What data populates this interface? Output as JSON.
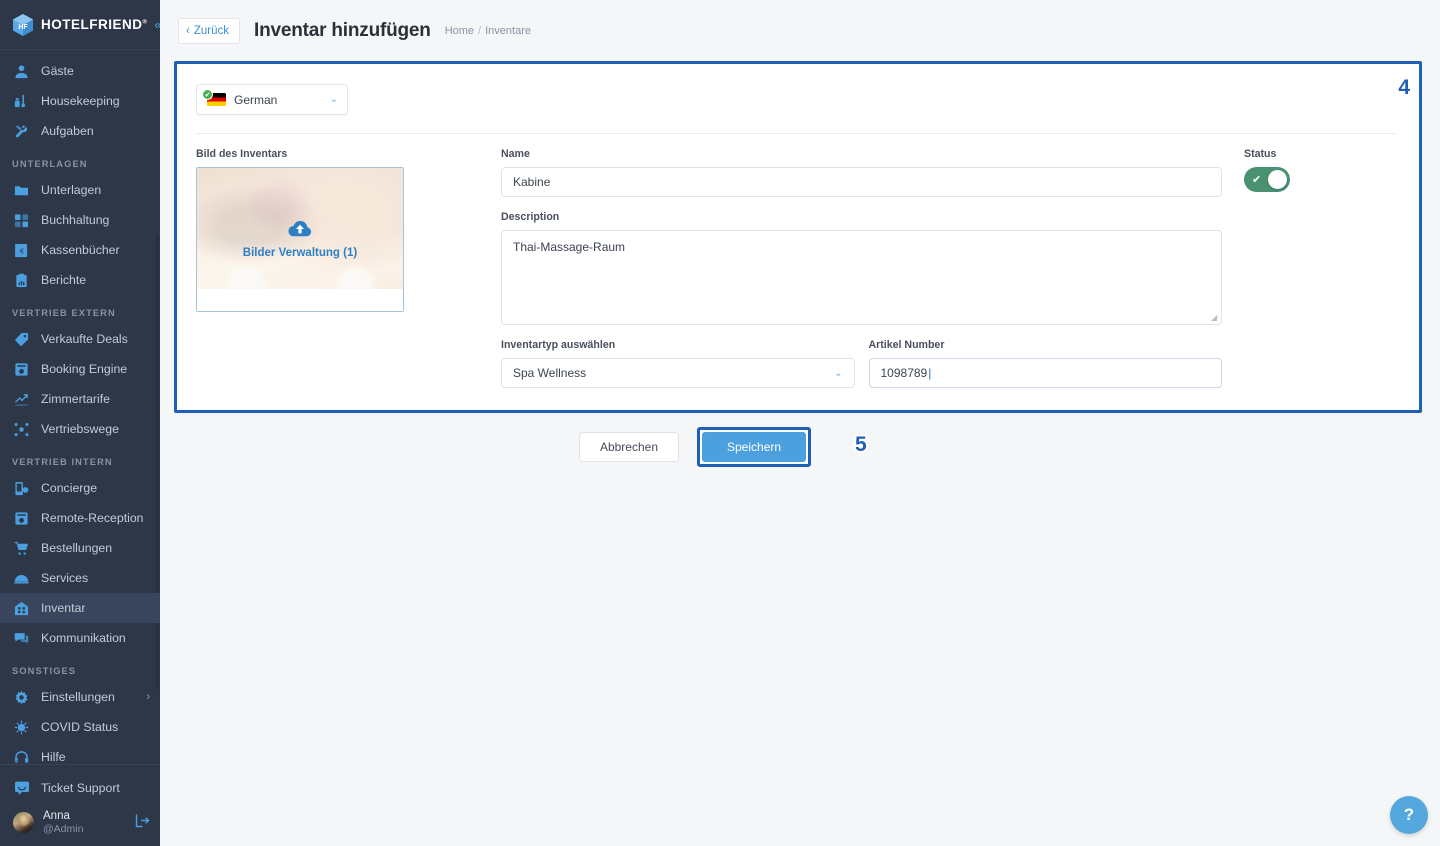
{
  "brand": {
    "name": "HOTELFRIEND",
    "trademark": "®",
    "collapse_icon": "«"
  },
  "sidebar": {
    "groups": [
      {
        "section": null,
        "items": [
          {
            "label": "Gäste",
            "icon": "guest-icon",
            "active": false
          },
          {
            "label": "Housekeeping",
            "icon": "housekeeping-icon",
            "active": false
          },
          {
            "label": "Aufgaben",
            "icon": "tasks-icon",
            "active": false
          }
        ]
      },
      {
        "section": "UNTERLAGEN",
        "items": [
          {
            "label": "Unterlagen",
            "icon": "folder-icon",
            "active": false
          },
          {
            "label": "Buchhaltung",
            "icon": "accounting-icon",
            "active": false
          },
          {
            "label": "Kassenbücher",
            "icon": "cashbook-icon",
            "active": false
          },
          {
            "label": "Berichte",
            "icon": "reports-icon",
            "active": false
          }
        ]
      },
      {
        "section": "VERTRIEB EXTERN",
        "items": [
          {
            "label": "Verkaufte Deals",
            "icon": "tag-icon",
            "active": false
          },
          {
            "label": "Booking Engine",
            "icon": "booking-engine-icon",
            "active": false
          },
          {
            "label": "Zimmertarife",
            "icon": "room-rates-icon",
            "active": false
          },
          {
            "label": "Vertriebswege",
            "icon": "distribution-icon",
            "active": false
          }
        ]
      },
      {
        "section": "VERTRIEB INTERN",
        "items": [
          {
            "label": "Concierge",
            "icon": "concierge-icon",
            "active": false
          },
          {
            "label": "Remote-Reception",
            "icon": "remote-reception-icon",
            "active": false
          },
          {
            "label": "Bestellungen",
            "icon": "cart-icon",
            "active": false
          },
          {
            "label": "Services",
            "icon": "services-icon",
            "active": false
          },
          {
            "label": "Inventar",
            "icon": "inventory-icon",
            "active": true
          },
          {
            "label": "Kommunikation",
            "icon": "communication-icon",
            "active": false
          }
        ]
      },
      {
        "section": "SONSTIGES",
        "items": [
          {
            "label": "Einstellungen",
            "icon": "gear-icon",
            "active": false,
            "chevron": "›"
          },
          {
            "label": "COVID Status",
            "icon": "virus-icon",
            "active": false
          },
          {
            "label": "Hilfe",
            "icon": "headset-icon",
            "active": false
          }
        ]
      }
    ],
    "support": {
      "label": "Ticket Support",
      "icon": "chat-icon"
    },
    "user": {
      "name": "Anna",
      "handle": "@Admin",
      "logout_icon": "logout-icon"
    }
  },
  "topbar": {
    "back_label": "Zurück",
    "back_icon": "chevron-left-icon",
    "title": "Inventar hinzufügen",
    "breadcrumb": {
      "home": "Home",
      "separator": "/",
      "current": "Inventare"
    }
  },
  "form": {
    "marker_card": "4",
    "marker_save": "5",
    "language": {
      "value": "German",
      "flag": "flag-de",
      "check": "✔",
      "caret": "⌄"
    },
    "image": {
      "label": "Bild des Inventars",
      "overlay_text": "Bilder Verwaltung (1)",
      "upload_icon": "cloud-upload-icon"
    },
    "name": {
      "label": "Name",
      "value": "Kabine"
    },
    "description": {
      "label": "Description",
      "value": "Thai-Massage-Raum"
    },
    "inventory_type": {
      "label": "Inventartyp auswählen",
      "value": "Spa Wellness",
      "caret": "⌄"
    },
    "article_number": {
      "label": "Artikel Number",
      "value": "1098789",
      "caret": "|"
    },
    "status": {
      "label": "Status",
      "on": true,
      "check": "✔"
    }
  },
  "actions": {
    "cancel": "Abbrechen",
    "save": "Speichern"
  },
  "help": {
    "label": "?"
  },
  "colors": {
    "sidebar_bg": "#2d3748",
    "sidebar_active": "#39455c",
    "accent_blue": "#4a9fe0",
    "annotation_blue": "#1f5fb5",
    "save_blue": "#4da0de",
    "toggle_green": "#4a9171",
    "page_bg": "#f4f6f8"
  }
}
